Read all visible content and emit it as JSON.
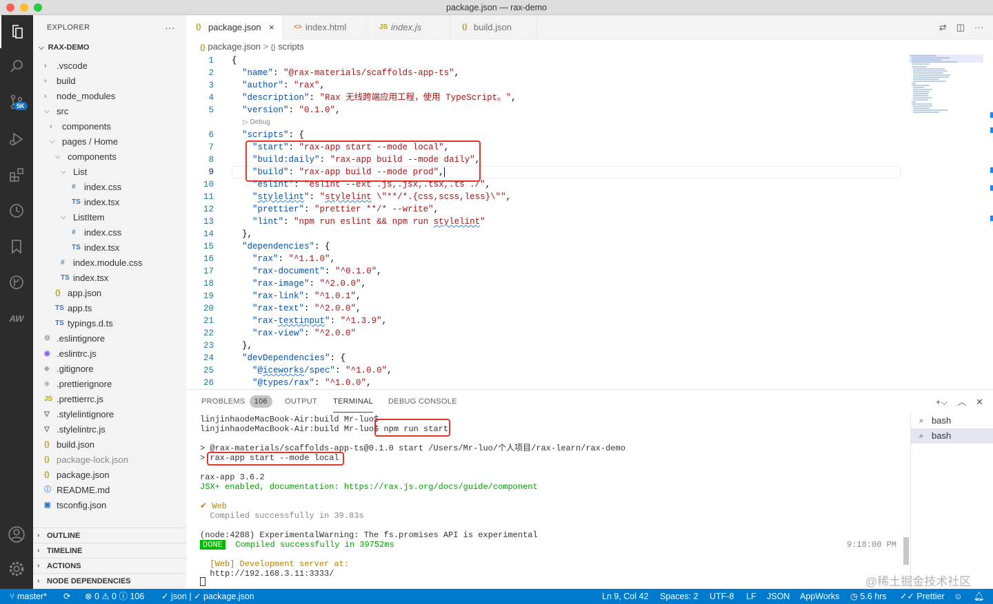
{
  "window": {
    "title": "package.json — rax-demo"
  },
  "colors": {
    "accent": "#007acc",
    "highlight_box": "#e5322b",
    "activity_bg": "#2c2c2c"
  },
  "activity_bar": {
    "badge": "5K",
    "items": [
      "explorer-icon",
      "search-icon",
      "source-control-icon",
      "run-debug-icon",
      "extensions-icon",
      "timeline-icon",
      "bookmarks-icon",
      "git-graph-icon",
      "appworks-icon",
      "account-icon",
      "manage-gear-icon"
    ]
  },
  "explorer": {
    "title": "EXPLORER",
    "more": "···",
    "root": "RAX-DEMO",
    "tree": [
      {
        "label": ".vscode",
        "type": "folder",
        "level": 1,
        "expanded": false
      },
      {
        "label": "build",
        "type": "folder",
        "level": 1,
        "expanded": false
      },
      {
        "label": "node_modules",
        "type": "folder",
        "level": 1,
        "expanded": false
      },
      {
        "label": "src",
        "type": "folder",
        "level": 1,
        "expanded": true
      },
      {
        "label": "components",
        "type": "folder",
        "level": 2,
        "expanded": false
      },
      {
        "label": "pages / Home",
        "type": "folder",
        "level": 2,
        "expanded": true
      },
      {
        "label": "components",
        "type": "folder",
        "level": 3,
        "expanded": true
      },
      {
        "label": "List",
        "type": "folder",
        "level": 4,
        "expanded": true
      },
      {
        "label": "index.css",
        "type": "css",
        "level": 5
      },
      {
        "label": "index.tsx",
        "type": "ts",
        "level": 5
      },
      {
        "label": "ListItem",
        "type": "folder",
        "level": 4,
        "expanded": true
      },
      {
        "label": "index.css",
        "type": "css",
        "level": 5
      },
      {
        "label": "index.tsx",
        "type": "ts",
        "level": 5
      },
      {
        "label": "index.module.css",
        "type": "css",
        "level": 3
      },
      {
        "label": "index.tsx",
        "type": "ts",
        "level": 3
      },
      {
        "label": "app.json",
        "type": "json",
        "level": 2
      },
      {
        "label": "app.ts",
        "type": "ts",
        "level": 2
      },
      {
        "label": "typings.d.ts",
        "type": "ts",
        "level": 2
      },
      {
        "label": ".eslintignore",
        "type": "gear",
        "level": 1
      },
      {
        "label": ".eslintrc.js",
        "type": "eslint",
        "level": 1
      },
      {
        "label": ".gitignore",
        "type": "git",
        "level": 1
      },
      {
        "label": ".prettierignore",
        "type": "prettier",
        "level": 1
      },
      {
        "label": ".prettierrc.js",
        "type": "js",
        "level": 1
      },
      {
        "label": ".stylelintignore",
        "type": "stylelint",
        "level": 1
      },
      {
        "label": ".stylelintrc.js",
        "type": "stylelint",
        "level": 1
      },
      {
        "label": "build.json",
        "type": "json",
        "level": 1
      },
      {
        "label": "package-lock.json",
        "type": "json",
        "level": 1,
        "dim": true
      },
      {
        "label": "package.json",
        "type": "json",
        "level": 1
      },
      {
        "label": "README.md",
        "type": "info",
        "level": 1
      },
      {
        "label": "tsconfig.json",
        "type": "tsconfig",
        "level": 1
      }
    ],
    "sections": [
      "OUTLINE",
      "TIMELINE",
      "ACTIONS",
      "NODE DEPENDENCIES"
    ]
  },
  "tabs": [
    {
      "label": "package.json",
      "icon": "{}",
      "active": true,
      "close": "×"
    },
    {
      "label": "index.html",
      "icon": "<>",
      "active": false
    },
    {
      "label": "index.js",
      "icon": "JS",
      "active": false
    },
    {
      "label": "build.json",
      "icon": "{}",
      "active": false
    }
  ],
  "breadcrumb": {
    "file": "package.json",
    "sep": ">",
    "symbol": "scripts"
  },
  "editor": {
    "code_lens": "▷ Debug",
    "lines": [
      {
        "n": "1",
        "code": [
          [
            "p",
            "{"
          ]
        ]
      },
      {
        "n": "2",
        "code": [
          [
            "p",
            "  "
          ],
          [
            "k",
            "\"name\""
          ],
          [
            "p",
            ": "
          ],
          [
            "s",
            "\"@rax-materials/scaffolds-app-ts\""
          ],
          [
            "p",
            ","
          ]
        ]
      },
      {
        "n": "3",
        "code": [
          [
            "p",
            "  "
          ],
          [
            "k",
            "\"author\""
          ],
          [
            "p",
            ": "
          ],
          [
            "s",
            "\"rax\""
          ],
          [
            "p",
            ","
          ]
        ]
      },
      {
        "n": "4",
        "code": [
          [
            "p",
            "  "
          ],
          [
            "k",
            "\"description\""
          ],
          [
            "p",
            ": "
          ],
          [
            "s",
            "\"Rax 无线跨端应用工程，使用 TypeScript。\""
          ],
          [
            "p",
            ","
          ]
        ]
      },
      {
        "n": "5",
        "code": [
          [
            "p",
            "  "
          ],
          [
            "k",
            "\"version\""
          ],
          [
            "p",
            ": "
          ],
          [
            "s",
            "\"0.1.0\""
          ],
          [
            "p",
            ","
          ]
        ]
      },
      {
        "n": "6",
        "code": [
          [
            "p",
            "  "
          ],
          [
            "k",
            "\"scripts\""
          ],
          [
            "p",
            ": {"
          ]
        ]
      },
      {
        "n": "7",
        "code": [
          [
            "p",
            "    "
          ],
          [
            "k",
            "\"start\""
          ],
          [
            "p",
            ": "
          ],
          [
            "s",
            "\"rax-app start --mode local\""
          ],
          [
            "p",
            ","
          ]
        ]
      },
      {
        "n": "8",
        "code": [
          [
            "p",
            "    "
          ],
          [
            "k",
            "\"build:daily\""
          ],
          [
            "p",
            ": "
          ],
          [
            "s",
            "\"rax-app build --mode daily\""
          ],
          [
            "p",
            ","
          ]
        ]
      },
      {
        "n": "9",
        "code": [
          [
            "p",
            "    "
          ],
          [
            "k",
            "\"build\""
          ],
          [
            "p",
            ": "
          ],
          [
            "s",
            "\"rax-app build --mode prod\""
          ],
          [
            "p",
            ","
          ]
        ]
      },
      {
        "n": "10",
        "code": [
          [
            "p",
            "    "
          ],
          [
            "k",
            "\"eslint\""
          ],
          [
            "p",
            ": "
          ],
          [
            "s",
            "\"eslint --ext .js,.jsx,.tsx,.ts ./\""
          ],
          [
            "p",
            ","
          ]
        ]
      },
      {
        "n": "11",
        "code": [
          [
            "p",
            "    "
          ],
          [
            "k",
            "\""
          ],
          [
            "ksq",
            "stylelint"
          ],
          [
            "k",
            "\""
          ],
          [
            "p",
            ": "
          ],
          [
            "s",
            "\""
          ],
          [
            "ssq",
            "stylelint"
          ],
          [
            "s",
            " \\\"**/*.{css,scss,less}\\\"\""
          ],
          [
            "p",
            ","
          ]
        ]
      },
      {
        "n": "12",
        "code": [
          [
            "p",
            "    "
          ],
          [
            "k",
            "\"prettier\""
          ],
          [
            "p",
            ": "
          ],
          [
            "s",
            "\"prettier **/* --write\""
          ],
          [
            "p",
            ","
          ]
        ]
      },
      {
        "n": "13",
        "code": [
          [
            "p",
            "    "
          ],
          [
            "k",
            "\"lint\""
          ],
          [
            "p",
            ": "
          ],
          [
            "s",
            "\"npm run eslint && npm run "
          ],
          [
            "ssq",
            "stylelint"
          ],
          [
            "s",
            "\""
          ]
        ]
      },
      {
        "n": "14",
        "code": [
          [
            "p",
            "  },"
          ]
        ]
      },
      {
        "n": "15",
        "code": [
          [
            "p",
            "  "
          ],
          [
            "k",
            "\"dependencies\""
          ],
          [
            "p",
            ": {"
          ]
        ]
      },
      {
        "n": "16",
        "code": [
          [
            "p",
            "    "
          ],
          [
            "k",
            "\"rax\""
          ],
          [
            "p",
            ": "
          ],
          [
            "s",
            "\"^1.1.0\""
          ],
          [
            "p",
            ","
          ]
        ]
      },
      {
        "n": "17",
        "code": [
          [
            "p",
            "    "
          ],
          [
            "k",
            "\"rax-document\""
          ],
          [
            "p",
            ": "
          ],
          [
            "s",
            "\"^0.1.0\""
          ],
          [
            "p",
            ","
          ]
        ]
      },
      {
        "n": "18",
        "code": [
          [
            "p",
            "    "
          ],
          [
            "k",
            "\"rax-image\""
          ],
          [
            "p",
            ": "
          ],
          [
            "s",
            "\"^2.0.0\""
          ],
          [
            "p",
            ","
          ]
        ]
      },
      {
        "n": "19",
        "code": [
          [
            "p",
            "    "
          ],
          [
            "k",
            "\"rax-link\""
          ],
          [
            "p",
            ": "
          ],
          [
            "s",
            "\"^1.0.1\""
          ],
          [
            "p",
            ","
          ]
        ]
      },
      {
        "n": "20",
        "code": [
          [
            "p",
            "    "
          ],
          [
            "k",
            "\"rax-text\""
          ],
          [
            "p",
            ": "
          ],
          [
            "s",
            "\"^2.0.0\""
          ],
          [
            "p",
            ","
          ]
        ]
      },
      {
        "n": "21",
        "code": [
          [
            "p",
            "    "
          ],
          [
            "k",
            "\"rax-"
          ],
          [
            "ksq",
            "textinput"
          ],
          [
            "k",
            "\""
          ],
          [
            "p",
            ": "
          ],
          [
            "s",
            "\"^1.3.9\""
          ],
          [
            "p",
            ","
          ]
        ]
      },
      {
        "n": "22",
        "code": [
          [
            "p",
            "    "
          ],
          [
            "k",
            "\"rax-view\""
          ],
          [
            "p",
            ": "
          ],
          [
            "s",
            "\"^2.0.0\""
          ]
        ]
      },
      {
        "n": "23",
        "code": [
          [
            "p",
            "  },"
          ]
        ]
      },
      {
        "n": "24",
        "code": [
          [
            "p",
            "  "
          ],
          [
            "k",
            "\"devDependencies\""
          ],
          [
            "p",
            ": {"
          ]
        ]
      },
      {
        "n": "25",
        "code": [
          [
            "p",
            "    "
          ],
          [
            "k",
            "\"@"
          ],
          [
            "ksq",
            "iceworks"
          ],
          [
            "k",
            "/spec\""
          ],
          [
            "p",
            ": "
          ],
          [
            "s",
            "\"^1.0.0\""
          ],
          [
            "p",
            ","
          ]
        ]
      },
      {
        "n": "26",
        "code": [
          [
            "p",
            "    "
          ],
          [
            "k",
            "\"@types/rax\""
          ],
          [
            "p",
            ": "
          ],
          [
            "s",
            "\"^1.0.0\""
          ],
          [
            "p",
            ","
          ]
        ]
      }
    ]
  },
  "panel": {
    "tabs": [
      "PROBLEMS",
      "OUTPUT",
      "TERMINAL",
      "DEBUG CONSOLE"
    ],
    "problems_count": "106",
    "active_tab": "TERMINAL",
    "terminal_lines": [
      "linjinhaodeMacBook-Air:build Mr-luo$",
      "linjinhaodeMacBook-Air:build Mr-luo$ npm run start",
      "",
      "> @rax-materials/scaffolds-app-ts@0.1.0 start /Users/Mr-luo/个人项目/rax-learn/rax-demo",
      "> rax-app start --mode local",
      "",
      "rax-app 3.6.2",
      "JSX+ enabled, documentation: https://rax.js.org/docs/guide/component",
      "",
      "✔ Web",
      "  Compiled successfully in 39.83s",
      "",
      "(node:4288) ExperimentalWarning: The fs.promises API is experimental",
      "DONE  Compiled successfully in 39752ms",
      "",
      "  [Web] Development server at:",
      "  http://192.168.3.11:3333/"
    ],
    "timestamp": "9:18:00 PM",
    "terminals": [
      "bash",
      "bash"
    ]
  },
  "watermark": "@稀土掘金技术社区",
  "status_bar": {
    "branch": "master*",
    "sync": "⟳",
    "problems": "⊗ 0 ⚠ 0 ⓘ 106",
    "breadcrumb": "✓ json | ✓ package.json",
    "cursor": "Ln 9, Col 42",
    "spaces": "Spaces: 2",
    "encoding": "UTF-8",
    "eol": "LF",
    "language": "JSON",
    "appworks": "AppWorks",
    "time": "5.6 hrs",
    "prettier": "✓✓ Prettier"
  }
}
